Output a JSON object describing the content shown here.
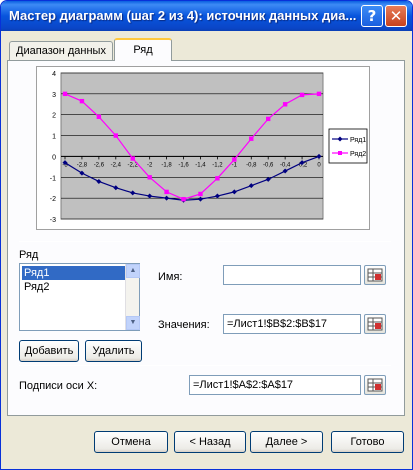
{
  "window": {
    "title": "Мастер диаграмм (шаг 2 из 4): источник данных диа..."
  },
  "tabs": [
    {
      "label": "Диапазон данных"
    },
    {
      "label": "Ряд"
    }
  ],
  "chart_data": {
    "type": "line",
    "categories": [
      "-3",
      "-2,8",
      "-2,6",
      "-2,4",
      "-2,2",
      "-2",
      "-1,8",
      "-1,6",
      "-1,4",
      "-1,2",
      "-1",
      "-0,8",
      "-0,6",
      "-0,4",
      "-0,2",
      "0"
    ],
    "series": [
      {
        "name": "Ряд1",
        "color": "#000080",
        "values": [
          -0.3,
          -0.8,
          -1.2,
          -1.5,
          -1.75,
          -1.9,
          -2.0,
          -2.1,
          -2.05,
          -1.9,
          -1.7,
          -1.4,
          -1.1,
          -0.7,
          -0.3,
          0.0
        ]
      },
      {
        "name": "Ряд2",
        "color": "#ff00ff",
        "values": [
          3.0,
          2.65,
          1.9,
          1.0,
          -0.1,
          -1.0,
          -1.7,
          -2.05,
          -1.8,
          -1.05,
          -0.15,
          0.85,
          1.8,
          2.5,
          2.95,
          3.0
        ]
      }
    ],
    "ylim": [
      -3,
      4
    ],
    "yticks": [
      "-3",
      "-2",
      "-1",
      "0",
      "1",
      "2",
      "3",
      "4"
    ],
    "plot_background": "#c0c0c0",
    "grid": true,
    "legend_position": "right"
  },
  "series_section": {
    "label": "Ряд",
    "items": [
      {
        "label": "Ряд1",
        "selected": true
      },
      {
        "label": "Ряд2",
        "selected": false
      }
    ],
    "add_button": "Добавить",
    "delete_button": "Удалить"
  },
  "fields": {
    "name_label": "Имя:",
    "name_value": "",
    "values_label": "Значения:",
    "values_value": "=Лист1!$B$2:$B$17",
    "x_labels_label": "Подписи оси X:",
    "x_labels_value": "=Лист1!$A$2:$A$17"
  },
  "buttons": {
    "cancel": "Отмена",
    "back": "< Назад",
    "next": "Далее >",
    "finish": "Готово"
  },
  "icons": {
    "help": "?",
    "close": "✕"
  }
}
